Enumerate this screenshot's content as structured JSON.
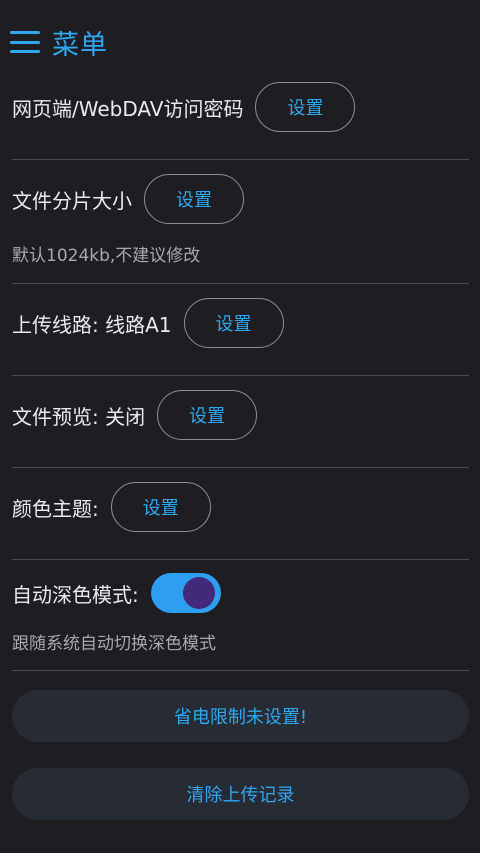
{
  "header": {
    "title": "菜单",
    "menu_icon": "hamburger-menu-icon",
    "accent_color": "#2ea8f0"
  },
  "settings": {
    "webdav_password": {
      "label": "网页端/WebDAV访问密码",
      "button": "设置"
    },
    "chunk_size": {
      "label": "文件分片大小",
      "button": "设置",
      "hint": "默认1024kb,不建议修改"
    },
    "upload_route": {
      "label": "上传线路: 线路A1",
      "button": "设置"
    },
    "file_preview": {
      "label": "文件预览: 关闭",
      "button": "设置"
    },
    "color_theme": {
      "label": "颜色主题:",
      "button": "设置"
    },
    "auto_dark": {
      "label": "自动深色模式:",
      "enabled": true,
      "hint": "跟随系统自动切换深色模式"
    }
  },
  "actions": {
    "battery_saver": "省电限制未设置!",
    "clear_upload_history": "清除上传记录"
  }
}
